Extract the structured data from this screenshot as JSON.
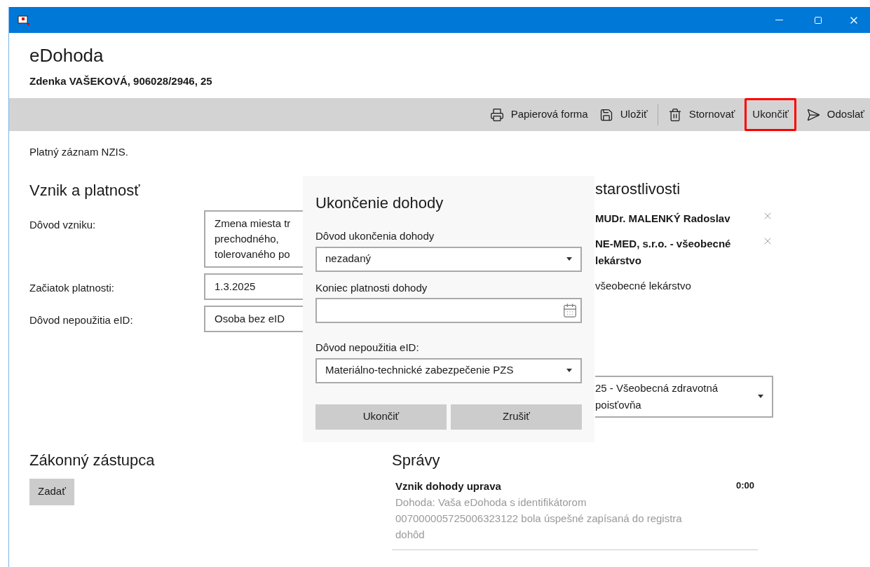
{
  "header": {
    "title": "eDohoda",
    "patient": "Zdenka VAŠEKOVÁ, 906028/2946, 25"
  },
  "toolbar": {
    "groups": [
      [
        {
          "label": "Papierová forma",
          "highlighted": false
        },
        {
          "label": "Uložiť",
          "highlighted": false
        }
      ],
      [
        {
          "label": "Stornovať",
          "highlighted": false
        },
        {
          "label": "Ukončiť",
          "highlighted": true
        },
        {
          "label": "Odoslať",
          "highlighted": false
        }
      ]
    ]
  },
  "status": "Platný záznam NZIS.",
  "origin": {
    "heading": "Vznik a platnosť",
    "fields": [
      {
        "label": "Dôvod vzniku:",
        "lines": [
          "Zmena miesta tr",
          "prechodného,",
          "tolerovaného po"
        ]
      },
      {
        "label": "Začiatok platnosti:",
        "lines": [
          "1.3.2025"
        ]
      },
      {
        "label": "Dôvod nepoužitia eID:",
        "lines": [
          "Osoba bez eID"
        ]
      }
    ]
  },
  "care": {
    "heading": "starostlivosti",
    "items": [
      {
        "kind": "name",
        "text": "MUDr. MALENKÝ Radoslav",
        "removable": true
      },
      {
        "kind": "name",
        "text": "NE-MED, s.r.o. - všeobecné lekárstvo",
        "removable": true
      },
      {
        "kind": "value",
        "text": "všeobecné lekárstvo",
        "removable": false
      },
      {
        "kind": "dropdown",
        "text": "25 - Všeobecná zdravotná poisťovňa"
      }
    ]
  },
  "representative": {
    "heading": "Zákonný zástupca",
    "button": "Zadať"
  },
  "messages": {
    "heading": "Správy",
    "items": [
      {
        "title": "Vznik dohody uprava",
        "time": "0:00",
        "body": "Dohoda: Vaša eDohoda s identifikátorom 007000005725006323122 bola úspešné zapísaná do registra dohôd"
      }
    ]
  },
  "dialog": {
    "title": "Ukončenie dohody",
    "fields": [
      {
        "kind": "select",
        "label": "Dôvod ukončenia dohody",
        "value": "nezadaný"
      },
      {
        "kind": "date",
        "label": "Koniec platnosti dohody"
      },
      {
        "kind": "select",
        "label": "Dôvod nepoužitia eID:",
        "value": "Materiálno-technické zabezpečenie PZS"
      }
    ],
    "buttons": [
      "Ukončiť",
      "Zrušiť"
    ]
  }
}
